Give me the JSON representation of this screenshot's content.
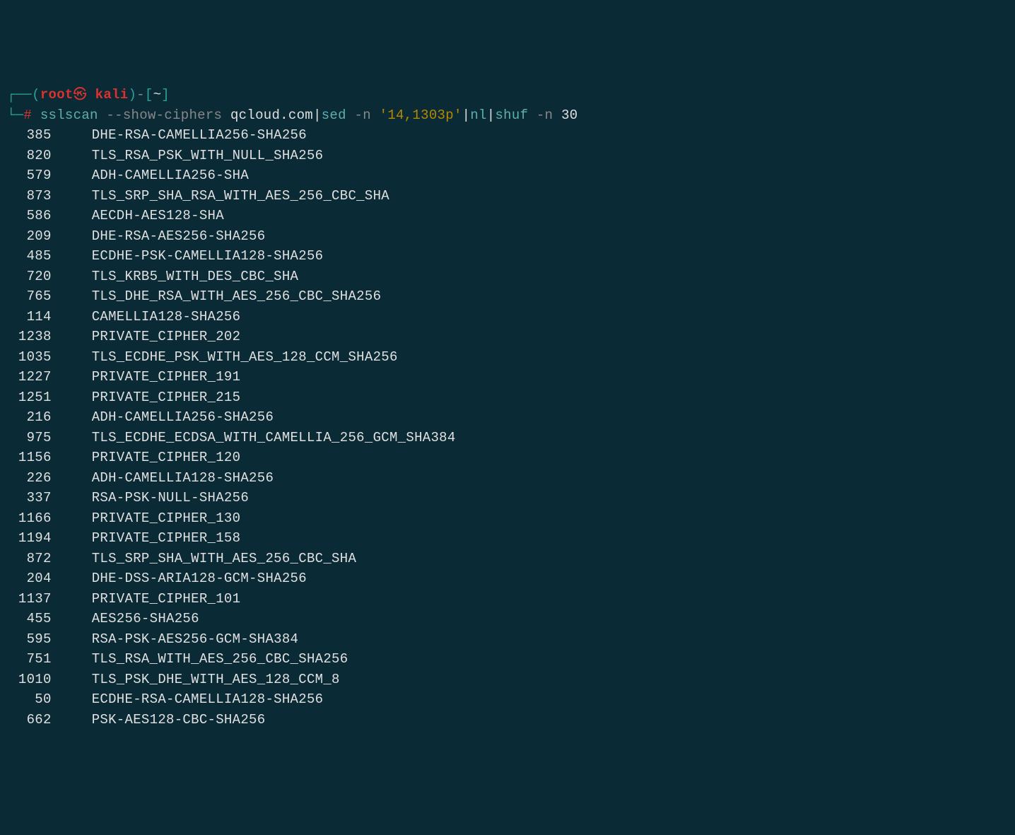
{
  "prompt": {
    "box1": "┌──",
    "paren_open": "(",
    "root": "root",
    "skull": "㉿",
    "kali": " kali",
    "paren_close": ")",
    "dash": "-",
    "bracket_open": "[",
    "tilde": "~",
    "bracket_close": "]",
    "box2": "└─",
    "hash": "#",
    "cmd_sslscan": "sslscan",
    "arg_show": " --show-ciphers ",
    "arg_host": "qcloud.com",
    "pipe1": "|",
    "cmd_sed": "sed",
    "sed_opt": " -n ",
    "sed_arg": "'14,1303p'",
    "pipe2": "|",
    "cmd_nl": "nl",
    "pipe3": "|",
    "cmd_shuf": "shuf",
    "shuf_opt": " -n ",
    "shuf_arg": "30"
  },
  "rows": [
    {
      "num": "385",
      "cipher": "DHE-RSA-CAMELLIA256-SHA256"
    },
    {
      "num": "820",
      "cipher": "TLS_RSA_PSK_WITH_NULL_SHA256"
    },
    {
      "num": "579",
      "cipher": "ADH-CAMELLIA256-SHA"
    },
    {
      "num": "873",
      "cipher": "TLS_SRP_SHA_RSA_WITH_AES_256_CBC_SHA"
    },
    {
      "num": "586",
      "cipher": "AECDH-AES128-SHA"
    },
    {
      "num": "209",
      "cipher": "DHE-RSA-AES256-SHA256"
    },
    {
      "num": "485",
      "cipher": "ECDHE-PSK-CAMELLIA128-SHA256"
    },
    {
      "num": "720",
      "cipher": "TLS_KRB5_WITH_DES_CBC_SHA"
    },
    {
      "num": "765",
      "cipher": "TLS_DHE_RSA_WITH_AES_256_CBC_SHA256"
    },
    {
      "num": "114",
      "cipher": "CAMELLIA128-SHA256"
    },
    {
      "num": "1238",
      "cipher": "PRIVATE_CIPHER_202"
    },
    {
      "num": "1035",
      "cipher": "TLS_ECDHE_PSK_WITH_AES_128_CCM_SHA256"
    },
    {
      "num": "1227",
      "cipher": "PRIVATE_CIPHER_191"
    },
    {
      "num": "1251",
      "cipher": "PRIVATE_CIPHER_215"
    },
    {
      "num": "216",
      "cipher": "ADH-CAMELLIA256-SHA256"
    },
    {
      "num": "975",
      "cipher": "TLS_ECDHE_ECDSA_WITH_CAMELLIA_256_GCM_SHA384"
    },
    {
      "num": "1156",
      "cipher": "PRIVATE_CIPHER_120"
    },
    {
      "num": "226",
      "cipher": "ADH-CAMELLIA128-SHA256"
    },
    {
      "num": "337",
      "cipher": "RSA-PSK-NULL-SHA256"
    },
    {
      "num": "1166",
      "cipher": "PRIVATE_CIPHER_130"
    },
    {
      "num": "1194",
      "cipher": "PRIVATE_CIPHER_158"
    },
    {
      "num": "872",
      "cipher": "TLS_SRP_SHA_WITH_AES_256_CBC_SHA"
    },
    {
      "num": "204",
      "cipher": "DHE-DSS-ARIA128-GCM-SHA256"
    },
    {
      "num": "1137",
      "cipher": "PRIVATE_CIPHER_101"
    },
    {
      "num": "455",
      "cipher": "AES256-SHA256"
    },
    {
      "num": "595",
      "cipher": "RSA-PSK-AES256-GCM-SHA384"
    },
    {
      "num": "751",
      "cipher": "TLS_RSA_WITH_AES_256_CBC_SHA256"
    },
    {
      "num": "1010",
      "cipher": "TLS_PSK_DHE_WITH_AES_128_CCM_8"
    },
    {
      "num": "50",
      "cipher": "ECDHE-RSA-CAMELLIA128-SHA256"
    },
    {
      "num": "662",
      "cipher": "PSK-AES128-CBC-SHA256"
    }
  ]
}
